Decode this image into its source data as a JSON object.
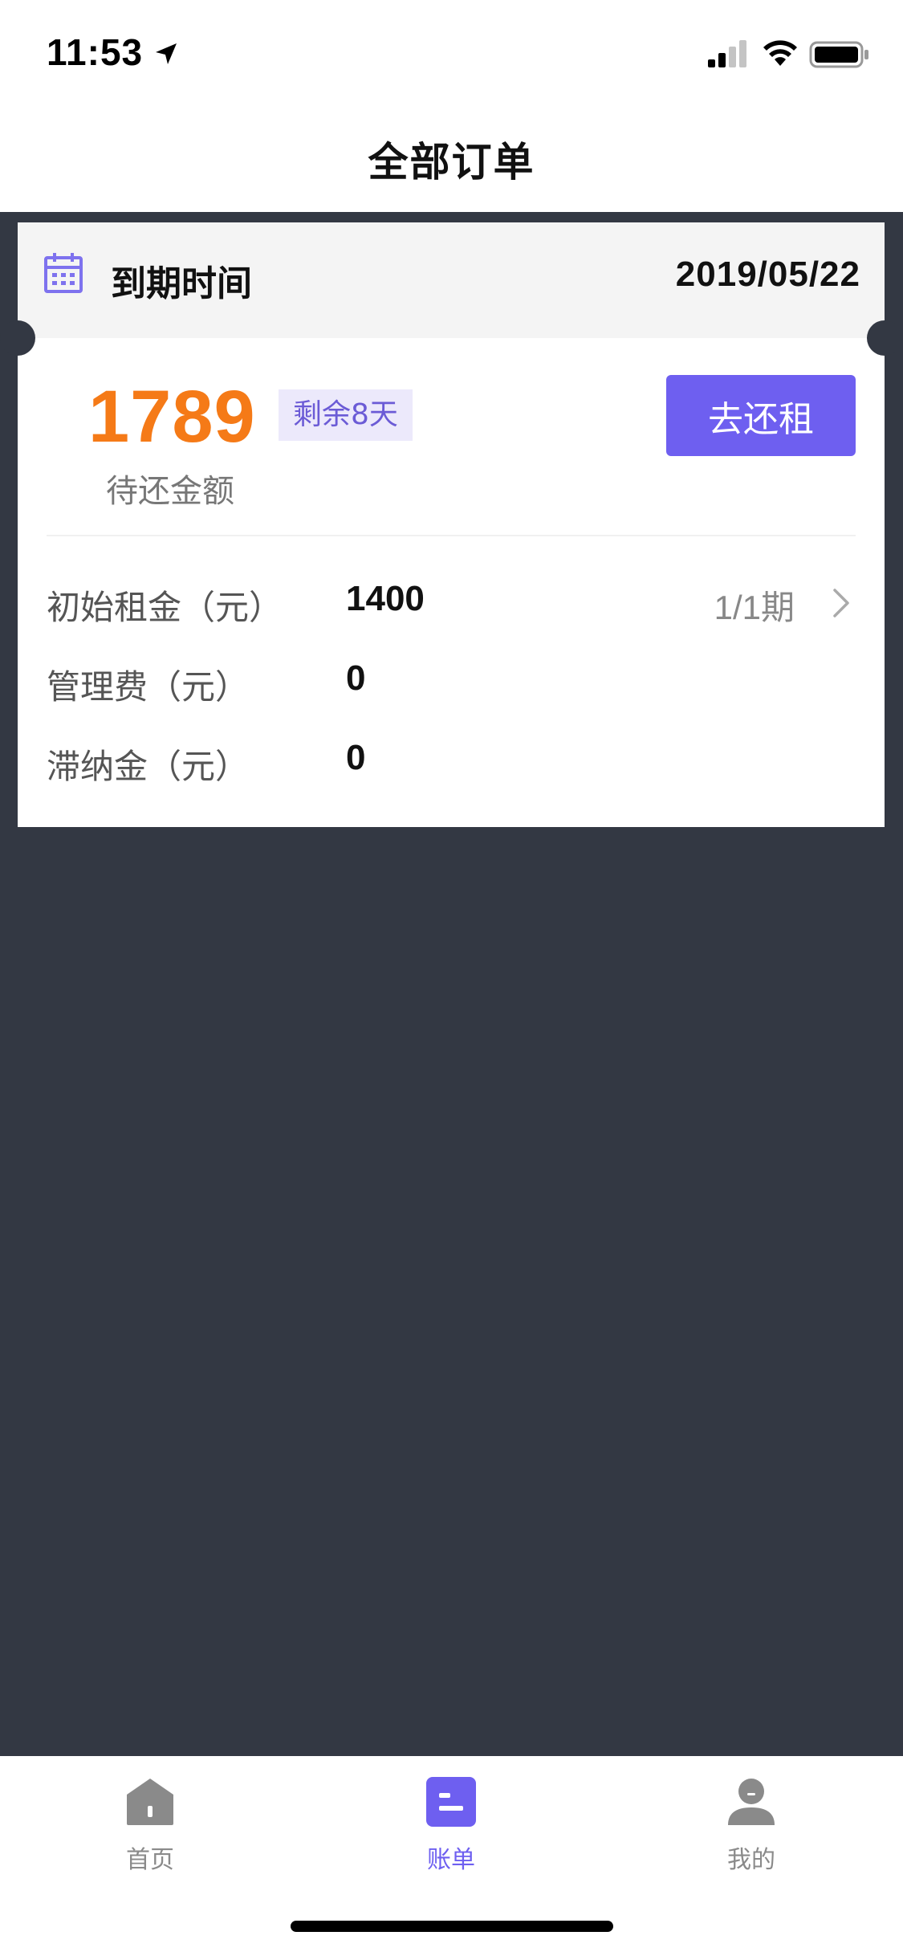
{
  "status_bar": {
    "time": "11:53",
    "icons": [
      "location-arrow-icon",
      "signal-icon",
      "wifi-icon",
      "battery-icon"
    ]
  },
  "nav": {
    "title": "全部订单"
  },
  "card": {
    "header": {
      "icon": "calendar-icon",
      "label": "到期时间",
      "date": "2019/05/22"
    },
    "amount": "1789",
    "remain_badge": "剩余8天",
    "amount_label": "待还金额",
    "pay_button": "去还租",
    "rows": [
      {
        "label": "初始租金（元）",
        "value": "1400",
        "period": "1/1期"
      },
      {
        "label": "管理费（元）",
        "value": "0"
      },
      {
        "label": "滞纳金（元）",
        "value": "0"
      }
    ]
  },
  "tabs": [
    {
      "label": "首页",
      "icon": "home-icon",
      "active": false
    },
    {
      "label": "账单",
      "icon": "bill-icon",
      "active": true
    },
    {
      "label": "我的",
      "icon": "profile-icon",
      "active": false
    }
  ],
  "colors": {
    "accent": "#6e5ff0",
    "amount": "#f57a17",
    "background": "#333843"
  }
}
